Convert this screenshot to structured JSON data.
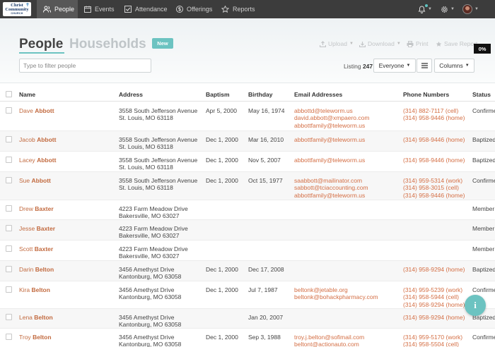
{
  "brand": {
    "line1": "Christ",
    "line2": "Community",
    "line3": "CHURCH"
  },
  "nav": {
    "people": "People",
    "events": "Events",
    "attendance": "Attendance",
    "offerings": "Offerings",
    "reports": "Reports"
  },
  "header": {
    "title_people": "People",
    "title_households": "Households",
    "new_label": "New",
    "filter_placeholder": "Type to filter people",
    "upload": "Upload",
    "download": "Download",
    "print": "Print",
    "save_report": "Save Report",
    "percent": "0%",
    "listing_label": "Listing",
    "listing_count": "247",
    "everyone_label": "Everyone",
    "columns_label": "Columns"
  },
  "columns": {
    "name": "Name",
    "address": "Address",
    "baptism": "Baptism",
    "birthday": "Birthday",
    "email": "Email Addresses",
    "phone": "Phone Numbers",
    "status": "Status"
  },
  "rows": [
    {
      "first": "Dave",
      "last": "Abbott",
      "addr1": "3558 South Jefferson Avenue",
      "addr2": "St. Louis, MO   63118",
      "baptism": "Apr 5, 2000",
      "birthday": "May 16, 1974",
      "emails": [
        "abbottd@teleworm.us",
        "david.abbott@xmpaero.com",
        "abbottfamily@teleworm.us"
      ],
      "phones": [
        {
          "num": "(314) 882-7117",
          "type": " (cell)"
        },
        {
          "num": "(314) 958-9446",
          "type": " (home)"
        }
      ],
      "status": "Confirme"
    },
    {
      "first": "Jacob",
      "last": "Abbott",
      "addr1": "3558 South Jefferson Avenue",
      "addr2": "St. Louis, MO   63118",
      "baptism": "Dec 1, 2000",
      "birthday": "Mar 16, 2010",
      "emails": [
        "abbottfamily@teleworm.us"
      ],
      "phones": [
        {
          "num": "(314) 958-9446",
          "type": " (home)"
        }
      ],
      "status": "Baptized"
    },
    {
      "first": "Lacey",
      "last": "Abbott",
      "addr1": "3558 South Jefferson Avenue",
      "addr2": "St. Louis, MO   63118",
      "baptism": "Dec 1, 2000",
      "birthday": "Nov 5, 2007",
      "emails": [
        "abbottfamily@teleworm.us"
      ],
      "phones": [
        {
          "num": "(314) 958-9446",
          "type": " (home)"
        }
      ],
      "status": "Baptized"
    },
    {
      "first": "Sue",
      "last": "Abbott",
      "addr1": "3558 South Jefferson Avenue",
      "addr2": "St. Louis, MO   63118",
      "baptism": "Dec 1, 2000",
      "birthday": "Oct 15, 1977",
      "emails": [
        "saabbott@mailinator.com",
        "sabbott@tciaccounting.com",
        "abbottfamily@teleworm.us"
      ],
      "phones": [
        {
          "num": "(314) 959-5314",
          "type": " (work)"
        },
        {
          "num": "(314) 958-3015",
          "type": " (cell)"
        },
        {
          "num": "(314) 958-9446",
          "type": " (home)"
        }
      ],
      "status": "Confirme"
    },
    {
      "first": "Drew",
      "last": "Baxter",
      "addr1": "4223 Farm Meadow Drive",
      "addr2": "Bakersville, MO   63027",
      "baptism": "",
      "birthday": "",
      "emails": [],
      "phones": [],
      "status": "Member"
    },
    {
      "first": "Jesse",
      "last": "Baxter",
      "addr1": "4223 Farm Meadow Drive",
      "addr2": "Bakersville, MO   63027",
      "baptism": "",
      "birthday": "",
      "emails": [],
      "phones": [],
      "status": "Member"
    },
    {
      "first": "Scott",
      "last": "Baxter",
      "addr1": "4223 Farm Meadow Drive",
      "addr2": "Bakersville, MO   63027",
      "baptism": "",
      "birthday": "",
      "emails": [],
      "phones": [],
      "status": "Member"
    },
    {
      "first": "Darin",
      "last": "Belton",
      "addr1": "3456 Amethyst Drive",
      "addr2": "Kantonburg, MO   63058",
      "baptism": "Dec 1, 2000",
      "birthday": "Dec 17, 2008",
      "emails": [],
      "phones": [
        {
          "num": "(314) 958-9294",
          "type": " (home)"
        }
      ],
      "status": "Baptized"
    },
    {
      "first": "Kira",
      "last": "Belton",
      "addr1": "3456 Amethyst Drive",
      "addr2": "Kantonburg, MO   63058",
      "baptism": "Dec 1, 2000",
      "birthday": "Jul 7, 1987",
      "emails": [
        "beltonk@jetable.org",
        "beltonk@bohackpharmacy.com"
      ],
      "phones": [
        {
          "num": "(314) 959-5239",
          "type": " (work)"
        },
        {
          "num": "(314) 958-5944",
          "type": " (cell)"
        },
        {
          "num": "(314) 958-9294",
          "type": " (home)"
        }
      ],
      "status": "Confirme"
    },
    {
      "first": "Lena",
      "last": "Belton",
      "addr1": "3456 Amethyst Drive",
      "addr2": "Kantonburg, MO   63058",
      "baptism": "",
      "birthday": "Jan 20, 2007",
      "emails": [],
      "phones": [
        {
          "num": "(314) 958-9294",
          "type": " (home)"
        }
      ],
      "status": "Baptized"
    },
    {
      "first": "Troy",
      "last": "Belton",
      "addr1": "3456 Amethyst Drive",
      "addr2": "Kantonburg, MO   63058",
      "baptism": "Dec 1, 2000",
      "birthday": "Sep 3, 1988",
      "emails": [
        "troy.j.belton@sofimail.com",
        "beltont@actionauto.com"
      ],
      "phones": [
        {
          "num": "(314) 959-5170",
          "type": " (work)"
        },
        {
          "num": "(314) 958-5504",
          "type": " (cell)"
        }
      ],
      "status": "Confirme"
    }
  ],
  "info_label": "i"
}
